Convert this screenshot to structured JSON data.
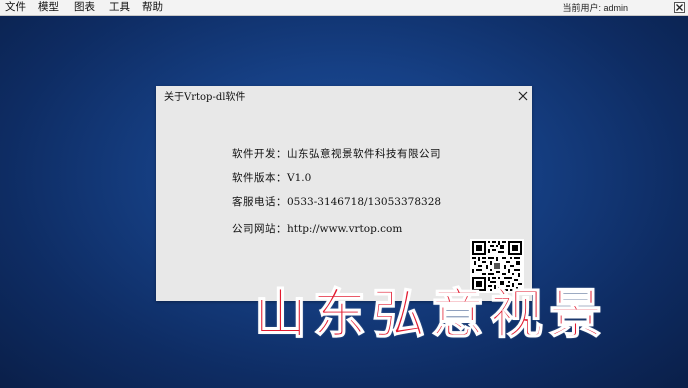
{
  "menubar": {
    "items": [
      "文件",
      "模型",
      "图表",
      "工具",
      "帮助"
    ],
    "user_label": "当前用户: admin"
  },
  "dialog": {
    "title": "关于Vrtop-dl软件",
    "rows": [
      {
        "label": "软件开发：",
        "value": "山东弘意视景软件科技有限公司"
      },
      {
        "label": "软件版本：",
        "value": "V1.0"
      },
      {
        "label": "客服电话：",
        "value": "0533-3146718/13053378328"
      },
      {
        "label": "公司网站：",
        "value": "http://www.vrtop.com"
      }
    ]
  },
  "brand_text": "山东弘意视景",
  "icons": {
    "menubar_close": "close-icon",
    "dialog_close": "close-icon",
    "qr": "qr-code-icon"
  },
  "colors": {
    "background": "#164085",
    "brand_text": "#e11a2f",
    "dialog_bg": "#e8e8e8"
  }
}
